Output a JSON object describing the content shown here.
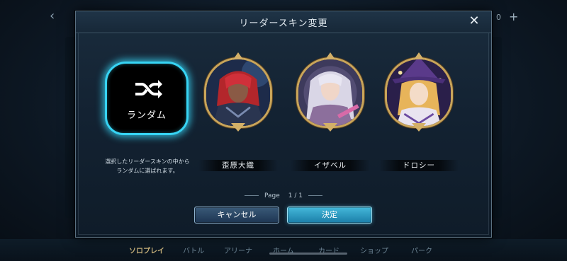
{
  "background": {
    "counter": "0",
    "nav": [
      {
        "label": "ソロプレイ",
        "active": true
      },
      {
        "label": "バトル",
        "active": false
      },
      {
        "label": "アリーナ",
        "active": false
      },
      {
        "label": "ホーム",
        "active": false
      },
      {
        "label": "カード",
        "active": false
      },
      {
        "label": "ショップ",
        "active": false
      },
      {
        "label": "パーク",
        "active": false
      }
    ]
  },
  "modal": {
    "title": "リーダースキン変更",
    "close_icon": "close-icon"
  },
  "random": {
    "label": "ランダム",
    "icon": "shuffle-icon",
    "description": "選択したリーダースキンの中から ランダムに選ばれます。",
    "glow_color": "#37d4f4"
  },
  "skins": [
    {
      "name": "歪原大織",
      "portrait": "red-haired-warrior"
    },
    {
      "name": "イザベル",
      "portrait": "silver-haired-mage"
    },
    {
      "name": "ドロシー",
      "portrait": "blonde-witch"
    }
  ],
  "pager": {
    "label": "Page",
    "current": "1",
    "total": "1",
    "text": "1 / 1"
  },
  "buttons": {
    "cancel": "キャンセル",
    "confirm": "決定"
  }
}
